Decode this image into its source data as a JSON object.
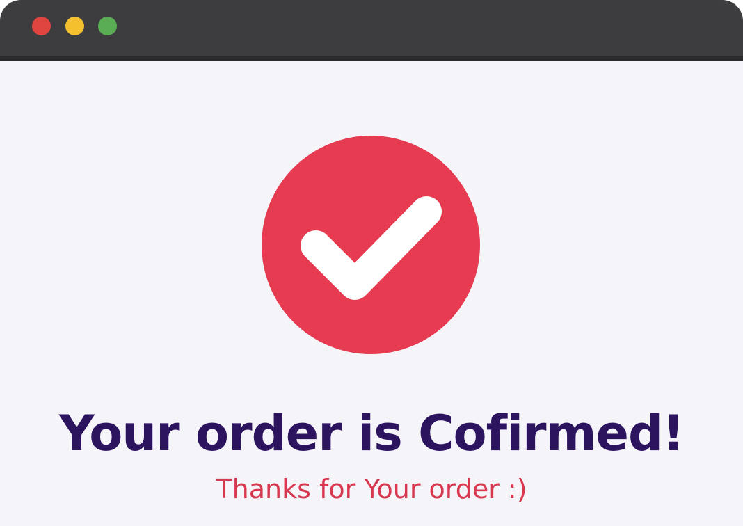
{
  "window": {
    "controls": [
      {
        "name": "close",
        "color": "#e0443e"
      },
      {
        "name": "minimize",
        "color": "#f5c02e"
      },
      {
        "name": "maximize",
        "color": "#5aad55"
      }
    ],
    "titlebar_color": "#3d3d3f",
    "background_color": "#f5f4f9"
  },
  "confirmation": {
    "icon": "checkmark-icon",
    "icon_color": "#e63b50",
    "headline": "Your order is Cofirmed!",
    "headline_color": "#2d145f",
    "subtext": "Thanks for Your order :)",
    "subtext_color": "#d8384f"
  }
}
